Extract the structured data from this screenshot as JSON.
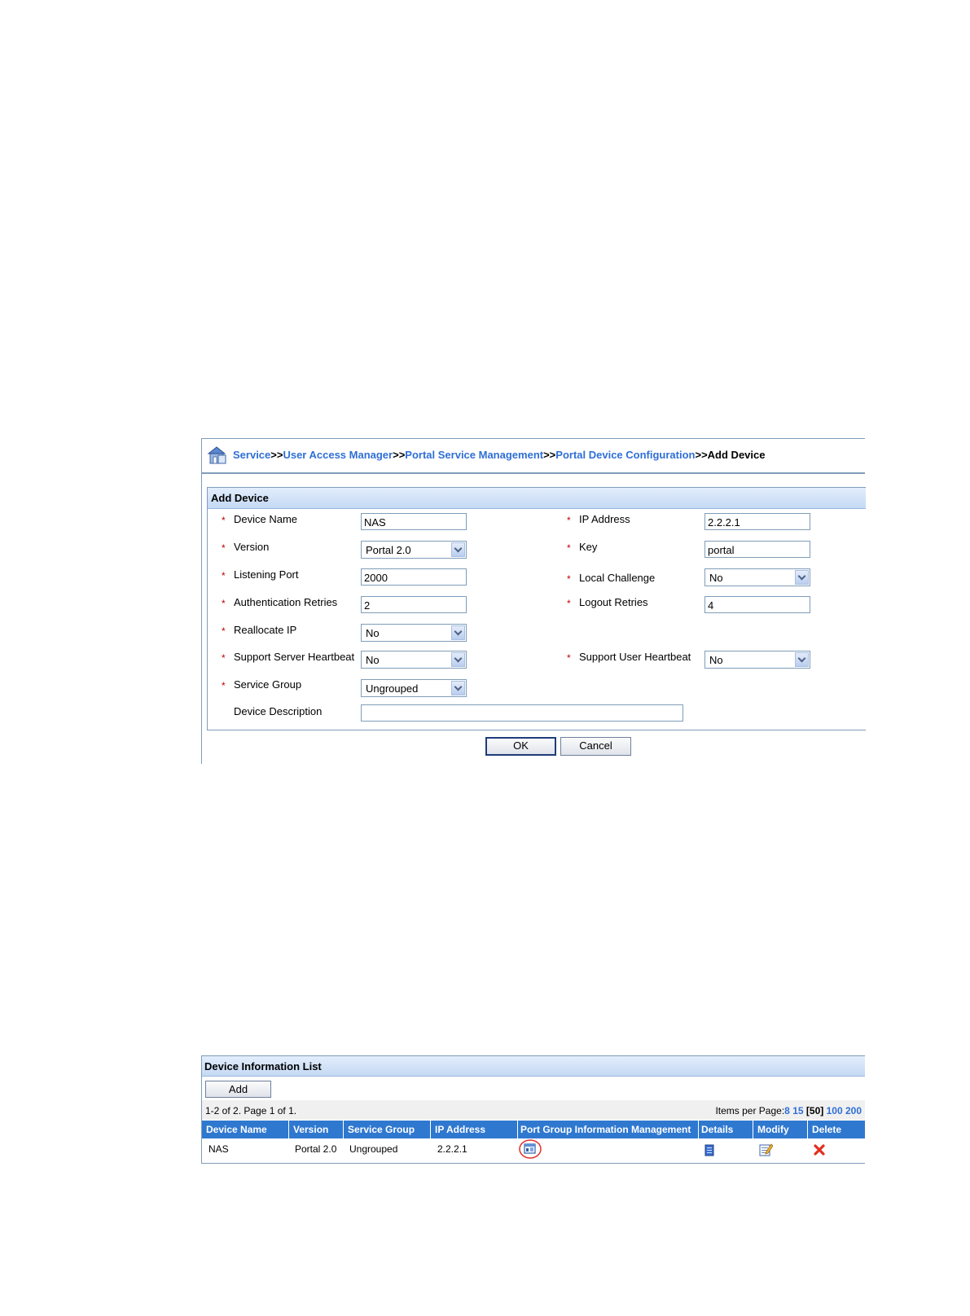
{
  "breadcrumb": {
    "items": [
      "Service",
      "User Access Manager",
      "Portal Service Management",
      "Portal Device Configuration"
    ],
    "separator": ">>",
    "current": "Add Device",
    "icon": "home-portal-icon"
  },
  "add_device_form": {
    "title": "Add Device",
    "required_mark": "*",
    "device_name": {
      "label": "Device Name",
      "value": "NAS"
    },
    "ip_address": {
      "label": "IP Address",
      "value": "2.2.2.1"
    },
    "version": {
      "label": "Version",
      "value": "Portal 2.0"
    },
    "key": {
      "label": "Key",
      "value": "portal"
    },
    "listening_port": {
      "label": "Listening Port",
      "value": "2000"
    },
    "local_challenge": {
      "label": "Local Challenge",
      "value": "No"
    },
    "authentication_retries": {
      "label": "Authentication Retries",
      "value": "2"
    },
    "logout_retries": {
      "label": "Logout Retries",
      "value": "4"
    },
    "reallocate_ip": {
      "label": "Reallocate IP",
      "value": "No"
    },
    "support_server_heartbeat": {
      "label": "Support Server Heartbeat",
      "value": "No"
    },
    "support_user_heartbeat": {
      "label": "Support User Heartbeat",
      "value": "No"
    },
    "service_group": {
      "label": "Service Group",
      "value": "Ungrouped"
    },
    "device_description": {
      "label": "Device Description",
      "value": ""
    },
    "ok_label": "OK",
    "cancel_label": "Cancel"
  },
  "device_list": {
    "title": "Device Information List",
    "add_label": "Add",
    "summary": "1-2 of 2. Page 1 of 1.",
    "items_per_page_label": "Items per Page:",
    "page_sizes": [
      "8",
      "15",
      "[50]",
      "100",
      "200"
    ],
    "columns": [
      "Device Name",
      "Version",
      "Service Group",
      "IP Address",
      "Port Group Information Management",
      "Details",
      "Modify",
      "Delete"
    ],
    "rows": [
      {
        "device_name": "NAS",
        "version": "Portal 2.0",
        "service_group": "Ungrouped",
        "ip_address": "2.2.2.1"
      }
    ]
  },
  "colors": {
    "link": "#2f6fd6",
    "header_bg": "#2f78d0",
    "required": "#c00000",
    "highlight_circle": "#e0302a"
  }
}
